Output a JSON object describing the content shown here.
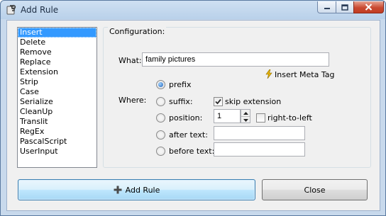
{
  "window": {
    "title": "Add Rule"
  },
  "rules_list": {
    "items": [
      "Insert",
      "Delete",
      "Remove",
      "Replace",
      "Extension",
      "Strip",
      "Case",
      "Serialize",
      "CleanUp",
      "Translit",
      "RegEx",
      "PascalScript",
      "UserInput"
    ],
    "selected": "Insert"
  },
  "config": {
    "group_label": "Configuration:",
    "what_label": "What:",
    "what_value": "family pictures",
    "meta_tag_label": "Insert Meta Tag",
    "where_label": "Where:",
    "options": {
      "prefix": "prefix",
      "suffix": "suffix:",
      "position": "position:",
      "after_text": "after text:",
      "before_text": "before text:"
    },
    "selected_option": "prefix",
    "skip_extension_label": "skip extension",
    "skip_extension_checked": true,
    "position_value": "1",
    "right_to_left_label": "right-to-left",
    "right_to_left_checked": false,
    "after_text_value": "",
    "before_text_value": ""
  },
  "buttons": {
    "add_rule": "Add Rule",
    "close": "Close"
  },
  "colors": {
    "selection": "#3399ff",
    "close_button": "#c94a31",
    "meta_tag_icon": "#e8b400"
  },
  "icons": {
    "app": "app-tool-icon",
    "meta": "lightning-icon",
    "add": "plus-icon"
  }
}
